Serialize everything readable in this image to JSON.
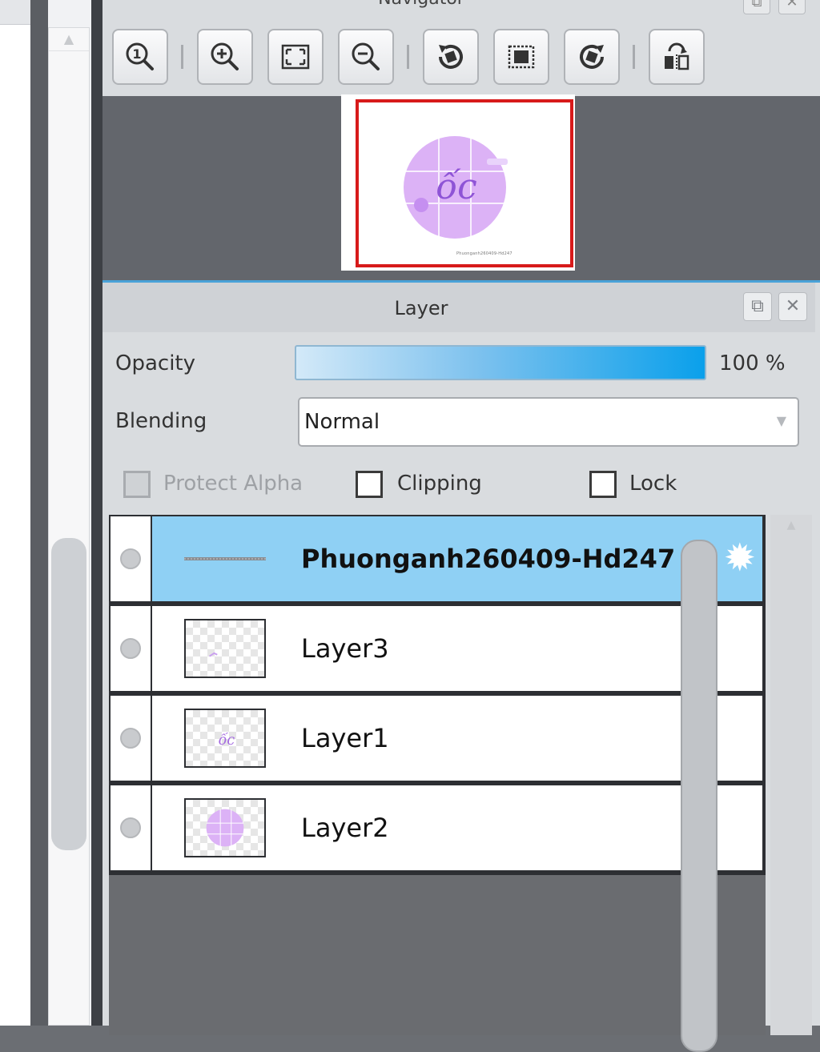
{
  "navigator": {
    "title": "Navigator",
    "toolbar": [
      {
        "name": "zoom-actual-size-button",
        "icon": "zoom-one-icon"
      },
      {
        "name": "zoom-in-button",
        "icon": "zoom-in-icon"
      },
      {
        "name": "fit-window-button",
        "icon": "fit-window-icon"
      },
      {
        "name": "zoom-out-button",
        "icon": "zoom-out-icon"
      },
      {
        "name": "rotate-left-button",
        "icon": "rotate-left-icon"
      },
      {
        "name": "reset-rotation-button",
        "icon": "reset-view-icon"
      },
      {
        "name": "rotate-right-button",
        "icon": "rotate-right-icon"
      },
      {
        "name": "flip-horizontal-button",
        "icon": "flip-horizontal-icon"
      }
    ],
    "preview_text": "Phuonganh260409-Hd247"
  },
  "layer_panel": {
    "title": "Layer",
    "opacity_label": "Opacity",
    "opacity_value": "100 %",
    "opacity_fraction": 1.0,
    "blending_label": "Blending",
    "blending_value": "Normal",
    "protect_alpha_label": "Protect Alpha",
    "clipping_label": "Clipping",
    "lock_label": "Lock",
    "layers": [
      {
        "name": "Phuonganh260409-Hd247",
        "selected": true,
        "type": "text"
      },
      {
        "name": "Layer3",
        "selected": false,
        "type": "raster"
      },
      {
        "name": "Layer1",
        "selected": false,
        "type": "raster"
      },
      {
        "name": "Layer2",
        "selected": false,
        "type": "raster"
      }
    ]
  },
  "colors": {
    "selected_row": "#8fd0f4",
    "accent_blue": "#0aa0eb",
    "navigator_frame": "#d71a1a",
    "artwork_purple": "#d9a8f5"
  }
}
